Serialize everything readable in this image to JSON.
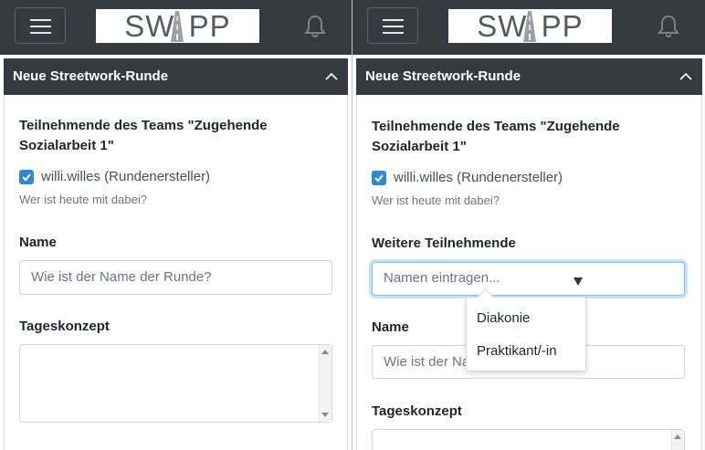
{
  "app": {
    "logo_text": "SW  PP",
    "icons": {
      "menu": "hamburger-icon",
      "notifications": "bell-icon",
      "collapse": "chevron-up-icon",
      "check": "checkmark-icon"
    }
  },
  "card": {
    "title": "Neue Streetwork-Runde"
  },
  "participants": {
    "heading": "Teilnehmende des Teams \"Zugehende Sozialarbeit 1\"",
    "self_label": "willi.willes (Rundenersteller)",
    "self_checked": true,
    "help": "Wer ist heute mit dabei?"
  },
  "further_participants": {
    "label": "Weitere Teilnehmende",
    "placeholder": "Namen eintragen...",
    "options": [
      "Diakonie",
      "Praktikant/-in"
    ]
  },
  "name_field": {
    "label": "Name",
    "placeholder": "Wie ist der Name der Runde?",
    "placeholder_truncated": "Wie ist der Na"
  },
  "tageskonzept": {
    "label": "Tageskonzept"
  },
  "colors": {
    "navbar": "#343a40",
    "accent": "#2f88d6",
    "focus_border": "#80bdff"
  }
}
